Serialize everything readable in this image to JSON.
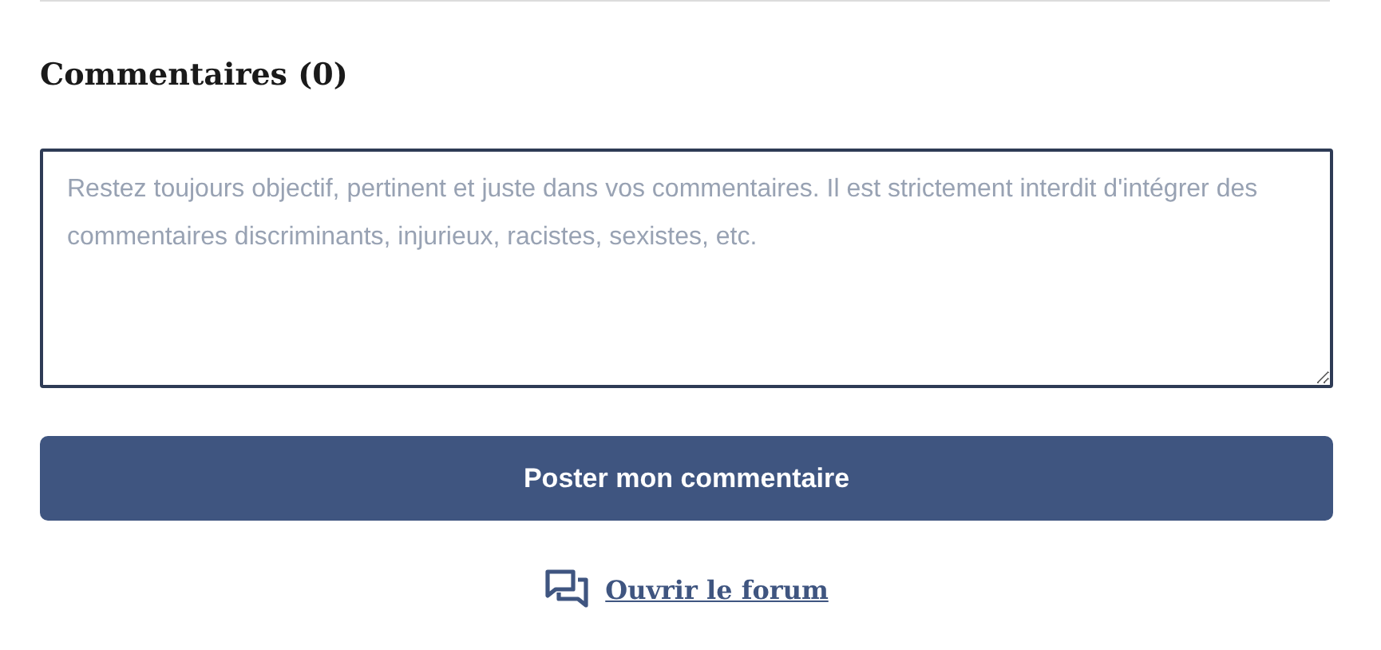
{
  "heading": "Commentaires (0)",
  "comment": {
    "placeholder": "Restez toujours objectif, pertinent et juste dans vos commentaires. Il est strictement interdit d'intégrer des commentaires discriminants, injurieux, racistes, sexistes, etc."
  },
  "submit_button": "Poster mon commentaire",
  "forum_link": "Ouvrir le forum"
}
